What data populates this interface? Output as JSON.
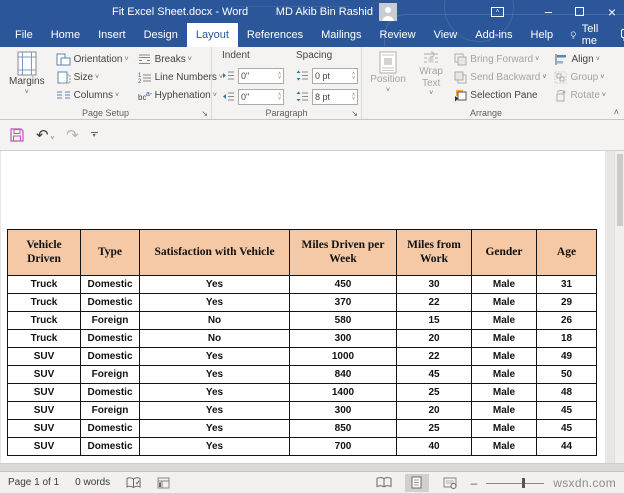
{
  "title_bar": {
    "title": "Fit Excel Sheet.docx - Word",
    "user": "MD Akib Bin Rashid",
    "minimize_glyph": "–",
    "close_glyph": "×"
  },
  "tabs": [
    "File",
    "Home",
    "Insert",
    "Design",
    "Layout",
    "References",
    "Mailings",
    "Review",
    "View",
    "Add-ins",
    "Help"
  ],
  "active_tab": "Layout",
  "tell_me": "Tell me",
  "ribbon": {
    "page_setup": {
      "label": "Page Setup",
      "margins": "Margins",
      "orientation": "Orientation",
      "size": "Size",
      "columns": "Columns",
      "breaks": "Breaks",
      "line_numbers": "Line Numbers",
      "hyphenation": "Hyphenation"
    },
    "paragraph": {
      "label": "Paragraph",
      "indent_label": "Indent",
      "spacing_label": "Spacing",
      "indent_left": "0\"",
      "indent_right": "0\"",
      "spacing_before": "0 pt",
      "spacing_after": "8 pt"
    },
    "arrange": {
      "label": "Arrange",
      "position": "Position",
      "wrap_text": "Wrap Text",
      "bring_forward": "Bring Forward",
      "send_backward": "Send Backward",
      "selection_pane": "Selection Pane",
      "align": "Align",
      "group": "Group",
      "rotate": "Rotate"
    }
  },
  "document_table": {
    "headers": [
      "Vehicle Driven",
      "Type",
      "Satisfaction with Vehicle",
      "Miles Driven per Week",
      "Miles from Work",
      "Gender",
      "Age"
    ],
    "rows": [
      [
        "Truck",
        "Domestic",
        "Yes",
        "450",
        "30",
        "Male",
        "31"
      ],
      [
        "Truck",
        "Domestic",
        "Yes",
        "370",
        "22",
        "Male",
        "29"
      ],
      [
        "Truck",
        "Foreign",
        "No",
        "580",
        "15",
        "Male",
        "26"
      ],
      [
        "Truck",
        "Domestic",
        "No",
        "300",
        "20",
        "Male",
        "18"
      ],
      [
        "SUV",
        "Domestic",
        "Yes",
        "1000",
        "22",
        "Male",
        "49"
      ],
      [
        "SUV",
        "Foreign",
        "Yes",
        "840",
        "45",
        "Male",
        "50"
      ],
      [
        "SUV",
        "Domestic",
        "Yes",
        "1400",
        "25",
        "Male",
        "48"
      ],
      [
        "SUV",
        "Foreign",
        "Yes",
        "300",
        "20",
        "Male",
        "45"
      ],
      [
        "SUV",
        "Domestic",
        "Yes",
        "850",
        "25",
        "Male",
        "45"
      ],
      [
        "SUV",
        "Domestic",
        "Yes",
        "700",
        "40",
        "Male",
        "44"
      ]
    ]
  },
  "status_bar": {
    "page_info": "Page 1 of 1",
    "word_count": "0 words",
    "watermark": "wsxdn.com"
  },
  "colors": {
    "title_bar": "#2B579A",
    "table_header_bg": "#F5C9A6",
    "accent": "#2B579A"
  }
}
